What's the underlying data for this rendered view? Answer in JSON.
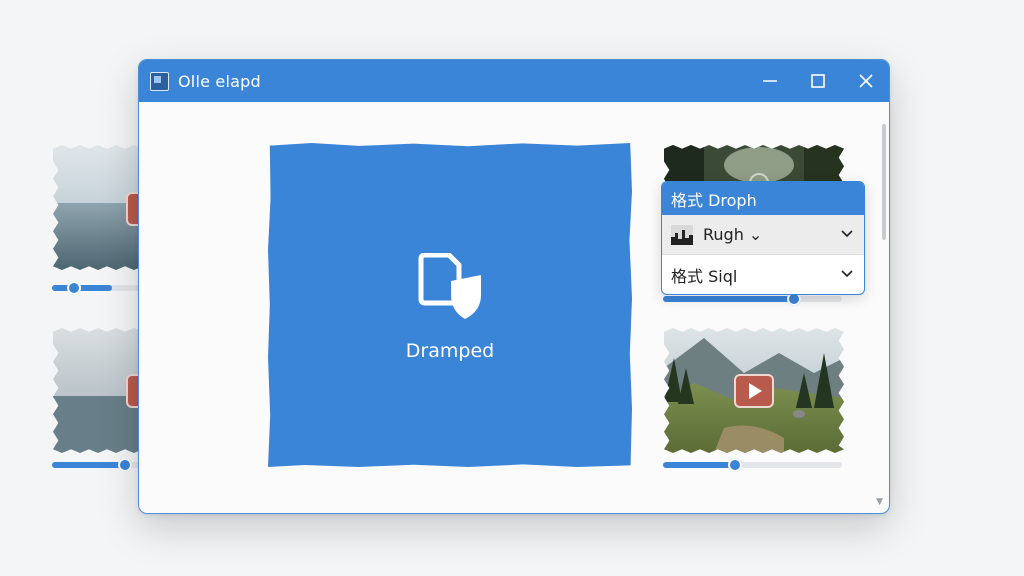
{
  "window": {
    "title": "Olle elapd",
    "accent": "#3b85d9",
    "controls": [
      "minimize-icon",
      "maximize-icon",
      "close-icon"
    ]
  },
  "drop_area": {
    "label": "Dramped",
    "icon": "file-shield-icon"
  },
  "dropdown": {
    "header": "格式 Droph",
    "items": [
      {
        "label": "Rugh ⌄",
        "icon": "image-thumbnail-icon",
        "selected": true
      },
      {
        "label": "格式 Siql",
        "selected": false
      }
    ]
  },
  "thumbnails": [
    {
      "name": "lake-woman",
      "progress": 0.33,
      "has_play": true
    },
    {
      "name": "woman-portrait",
      "progress": 0.4,
      "has_play": true
    },
    {
      "name": "forest",
      "progress": 0.72,
      "has_play": false
    },
    {
      "name": "mountain-valley",
      "progress": 0.4,
      "has_play": true
    }
  ]
}
